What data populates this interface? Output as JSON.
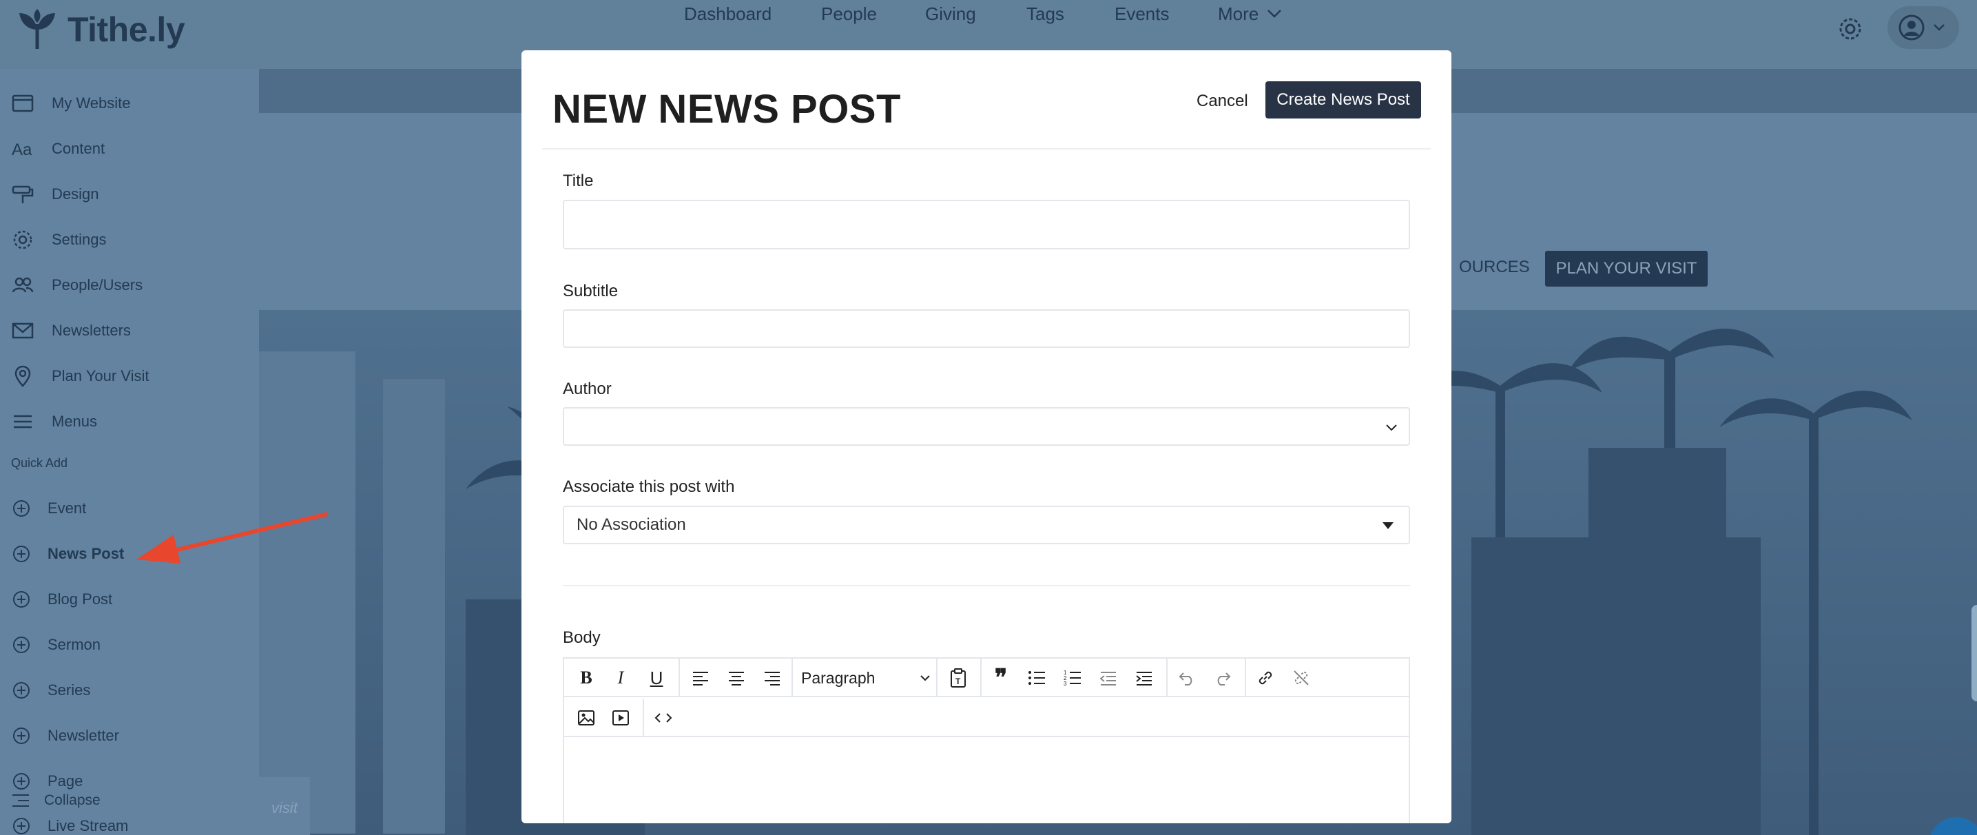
{
  "app": {
    "brand": "Tithe.ly"
  },
  "topnav": {
    "items": [
      "Dashboard",
      "People",
      "Giving",
      "Tags",
      "Events"
    ],
    "more_label": "More"
  },
  "sidebar": {
    "items": [
      {
        "label": "My Website",
        "icon": "browser-window-icon"
      },
      {
        "label": "Content",
        "icon": "text-aa-icon"
      },
      {
        "label": "Design",
        "icon": "paint-roller-icon"
      },
      {
        "label": "Settings",
        "icon": "gear-icon"
      },
      {
        "label": "People/Users",
        "icon": "people-icon"
      },
      {
        "label": "Newsletters",
        "icon": "envelope-icon"
      },
      {
        "label": "Plan Your Visit",
        "icon": "map-pin-icon"
      },
      {
        "label": "Menus",
        "icon": "menu-lines-icon"
      }
    ],
    "quick_add_label": "Quick Add",
    "quick_add": [
      "Event",
      "News Post",
      "Blog Post",
      "Sermon",
      "Series",
      "Newsletter",
      "Page",
      "Live Stream"
    ],
    "collapse_label": "Collapse"
  },
  "site": {
    "resources_text": "OURCES",
    "plan_visit_label": "PLAN YOUR VISIT",
    "hero_visit_text": "visit"
  },
  "modal": {
    "title": "NEW NEWS POST",
    "cancel_label": "Cancel",
    "create_label": "Create News Post",
    "fields": {
      "title_label": "Title",
      "title_value": "",
      "subtitle_label": "Subtitle",
      "subtitle_value": "",
      "author_label": "Author",
      "author_value": "",
      "assoc_label": "Associate this post with",
      "assoc_value": "No Association",
      "body_label": "Body"
    },
    "editor": {
      "block_format": "Paragraph"
    }
  },
  "colors": {
    "overlay_bg": "#5a7790",
    "nav_text": "#233a52",
    "primary_button": "#283446",
    "annotation_arrow": "#e8462d"
  }
}
